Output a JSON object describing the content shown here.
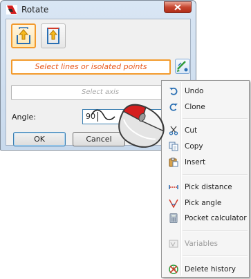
{
  "dialog": {
    "title": "Rotate",
    "select_lines_placeholder": "Select lines or isolated points",
    "select_axis_placeholder": "Select axis",
    "angle_label": "Angle:",
    "angle_value": "90",
    "ok_label": "OK",
    "cancel_label": "Cancel",
    "accent_color": "#f39a2b"
  },
  "context_menu": {
    "items": [
      {
        "label": "Undo",
        "icon": "undo-icon",
        "enabled": true
      },
      {
        "label": "Clone",
        "icon": "redo-icon",
        "enabled": true
      },
      {
        "label": "Cut",
        "icon": "scissors-icon",
        "enabled": true
      },
      {
        "label": "Copy",
        "icon": "copy-icon",
        "enabled": true
      },
      {
        "label": "Insert",
        "icon": "paste-icon",
        "enabled": true
      },
      {
        "label": "Pick distance",
        "icon": "pick-distance-icon",
        "enabled": true
      },
      {
        "label": "Pick angle",
        "icon": "pick-angle-icon",
        "enabled": true
      },
      {
        "label": "Pocket calculator",
        "icon": "calculator-icon",
        "enabled": true
      },
      {
        "label": "Variables",
        "icon": "variables-icon",
        "enabled": false
      },
      {
        "label": "Delete history",
        "icon": "delete-history-icon",
        "enabled": true
      }
    ]
  }
}
